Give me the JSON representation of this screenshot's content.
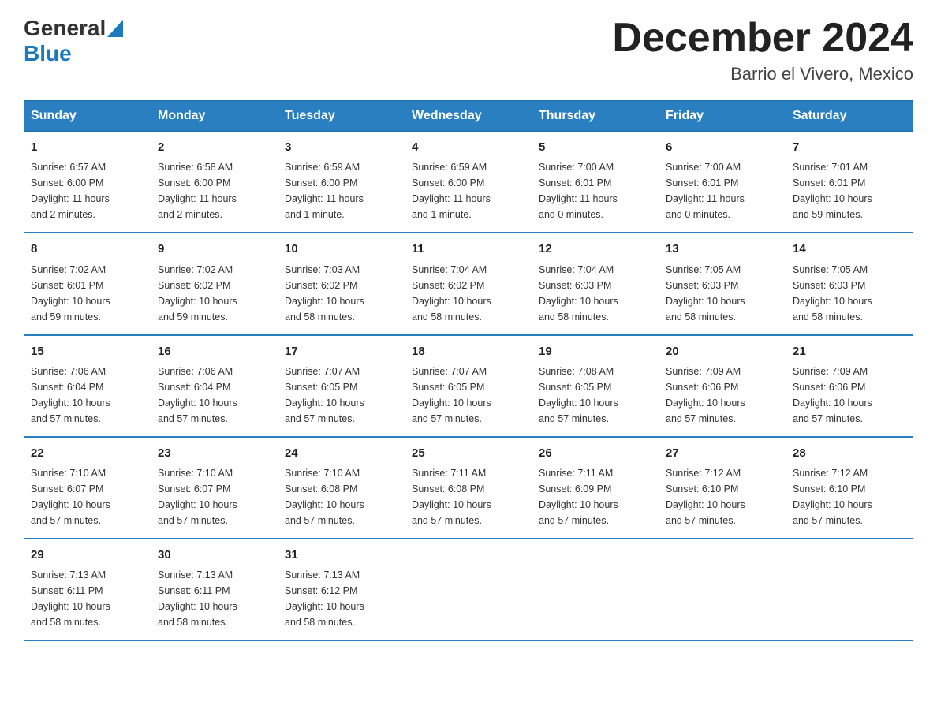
{
  "header": {
    "logo_general": "General",
    "logo_blue": "Blue",
    "month_title": "December 2024",
    "location": "Barrio el Vivero, Mexico"
  },
  "days_of_week": [
    "Sunday",
    "Monday",
    "Tuesday",
    "Wednesday",
    "Thursday",
    "Friday",
    "Saturday"
  ],
  "weeks": [
    [
      {
        "day": "1",
        "info": "Sunrise: 6:57 AM\nSunset: 6:00 PM\nDaylight: 11 hours\nand 2 minutes."
      },
      {
        "day": "2",
        "info": "Sunrise: 6:58 AM\nSunset: 6:00 PM\nDaylight: 11 hours\nand 2 minutes."
      },
      {
        "day": "3",
        "info": "Sunrise: 6:59 AM\nSunset: 6:00 PM\nDaylight: 11 hours\nand 1 minute."
      },
      {
        "day": "4",
        "info": "Sunrise: 6:59 AM\nSunset: 6:00 PM\nDaylight: 11 hours\nand 1 minute."
      },
      {
        "day": "5",
        "info": "Sunrise: 7:00 AM\nSunset: 6:01 PM\nDaylight: 11 hours\nand 0 minutes."
      },
      {
        "day": "6",
        "info": "Sunrise: 7:00 AM\nSunset: 6:01 PM\nDaylight: 11 hours\nand 0 minutes."
      },
      {
        "day": "7",
        "info": "Sunrise: 7:01 AM\nSunset: 6:01 PM\nDaylight: 10 hours\nand 59 minutes."
      }
    ],
    [
      {
        "day": "8",
        "info": "Sunrise: 7:02 AM\nSunset: 6:01 PM\nDaylight: 10 hours\nand 59 minutes."
      },
      {
        "day": "9",
        "info": "Sunrise: 7:02 AM\nSunset: 6:02 PM\nDaylight: 10 hours\nand 59 minutes."
      },
      {
        "day": "10",
        "info": "Sunrise: 7:03 AM\nSunset: 6:02 PM\nDaylight: 10 hours\nand 58 minutes."
      },
      {
        "day": "11",
        "info": "Sunrise: 7:04 AM\nSunset: 6:02 PM\nDaylight: 10 hours\nand 58 minutes."
      },
      {
        "day": "12",
        "info": "Sunrise: 7:04 AM\nSunset: 6:03 PM\nDaylight: 10 hours\nand 58 minutes."
      },
      {
        "day": "13",
        "info": "Sunrise: 7:05 AM\nSunset: 6:03 PM\nDaylight: 10 hours\nand 58 minutes."
      },
      {
        "day": "14",
        "info": "Sunrise: 7:05 AM\nSunset: 6:03 PM\nDaylight: 10 hours\nand 58 minutes."
      }
    ],
    [
      {
        "day": "15",
        "info": "Sunrise: 7:06 AM\nSunset: 6:04 PM\nDaylight: 10 hours\nand 57 minutes."
      },
      {
        "day": "16",
        "info": "Sunrise: 7:06 AM\nSunset: 6:04 PM\nDaylight: 10 hours\nand 57 minutes."
      },
      {
        "day": "17",
        "info": "Sunrise: 7:07 AM\nSunset: 6:05 PM\nDaylight: 10 hours\nand 57 minutes."
      },
      {
        "day": "18",
        "info": "Sunrise: 7:07 AM\nSunset: 6:05 PM\nDaylight: 10 hours\nand 57 minutes."
      },
      {
        "day": "19",
        "info": "Sunrise: 7:08 AM\nSunset: 6:05 PM\nDaylight: 10 hours\nand 57 minutes."
      },
      {
        "day": "20",
        "info": "Sunrise: 7:09 AM\nSunset: 6:06 PM\nDaylight: 10 hours\nand 57 minutes."
      },
      {
        "day": "21",
        "info": "Sunrise: 7:09 AM\nSunset: 6:06 PM\nDaylight: 10 hours\nand 57 minutes."
      }
    ],
    [
      {
        "day": "22",
        "info": "Sunrise: 7:10 AM\nSunset: 6:07 PM\nDaylight: 10 hours\nand 57 minutes."
      },
      {
        "day": "23",
        "info": "Sunrise: 7:10 AM\nSunset: 6:07 PM\nDaylight: 10 hours\nand 57 minutes."
      },
      {
        "day": "24",
        "info": "Sunrise: 7:10 AM\nSunset: 6:08 PM\nDaylight: 10 hours\nand 57 minutes."
      },
      {
        "day": "25",
        "info": "Sunrise: 7:11 AM\nSunset: 6:08 PM\nDaylight: 10 hours\nand 57 minutes."
      },
      {
        "day": "26",
        "info": "Sunrise: 7:11 AM\nSunset: 6:09 PM\nDaylight: 10 hours\nand 57 minutes."
      },
      {
        "day": "27",
        "info": "Sunrise: 7:12 AM\nSunset: 6:10 PM\nDaylight: 10 hours\nand 57 minutes."
      },
      {
        "day": "28",
        "info": "Sunrise: 7:12 AM\nSunset: 6:10 PM\nDaylight: 10 hours\nand 57 minutes."
      }
    ],
    [
      {
        "day": "29",
        "info": "Sunrise: 7:13 AM\nSunset: 6:11 PM\nDaylight: 10 hours\nand 58 minutes."
      },
      {
        "day": "30",
        "info": "Sunrise: 7:13 AM\nSunset: 6:11 PM\nDaylight: 10 hours\nand 58 minutes."
      },
      {
        "day": "31",
        "info": "Sunrise: 7:13 AM\nSunset: 6:12 PM\nDaylight: 10 hours\nand 58 minutes."
      },
      {
        "day": "",
        "info": ""
      },
      {
        "day": "",
        "info": ""
      },
      {
        "day": "",
        "info": ""
      },
      {
        "day": "",
        "info": ""
      }
    ]
  ]
}
